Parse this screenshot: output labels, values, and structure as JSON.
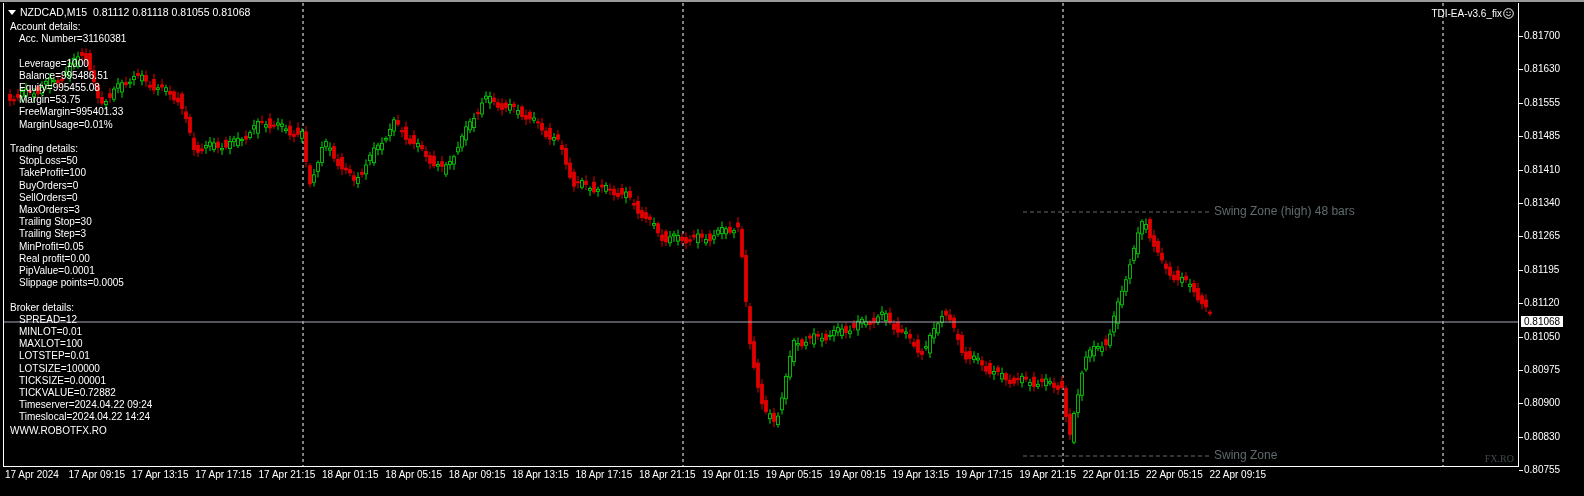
{
  "chart": {
    "symbol": "NZDCAD,M15",
    "quotes": "0.81112 0.81118 0.81055 0.81068",
    "expert": "TDI-EA-v3.6_fix",
    "info_sections": [
      {
        "heading": "Account details:",
        "groups": [
          [
            "Acc. Number=31160381"
          ],
          [
            "Leverage=1000",
            "Balance=995486.51",
            "Equity=995455.08",
            "Margin=53.75",
            "FreeMargin=995401.33",
            "MarginUsage=0.01%"
          ]
        ]
      },
      {
        "heading": "Trading details:",
        "groups": [
          [
            "StopLoss=50",
            "TakeProfit=100",
            "BuyOrders=0",
            "SellOrders=0",
            "MaxOrders=3",
            "Trailing Stop=30",
            "Trailing Step=3",
            "MinProfit=0.05",
            "Real profit=0.00",
            "PipValue=0.0001",
            "Slippage points=0.0005"
          ]
        ]
      },
      {
        "heading": "Broker details:",
        "groups": [
          [
            "SPREAD=12",
            "MINLOT=0.01",
            "MAXLOT=100",
            "LOTSTEP=0.01",
            "LOTSIZE=100000",
            "TICKSIZE=0.00001",
            "TICKVALUE=0.72882",
            "Timeserver=2024.04.22 09:24",
            "Timeslocal=2024.04.22 14:24"
          ]
        ]
      }
    ],
    "website": "WWW.ROBOTFX.RO",
    "swing_zones": [
      {
        "kind": "high",
        "label": "Swing Zone (high) 48 bars"
      },
      {
        "kind": "low",
        "label": "Swing Zone"
      }
    ],
    "corner_text": "FX.RO",
    "current_price": "0.81068"
  },
  "price_axis": [
    "0.81700",
    "0.81630",
    "0.81555",
    "0.81485",
    "0.81410",
    "0.81340",
    "0.81265",
    "0.81195",
    "0.81120",
    "0.81050",
    "0.80975",
    "0.80900",
    "0.80830",
    "0.80755"
  ],
  "time_axis": [
    "17 Apr 2024",
    "17 Apr 09:15",
    "17 Apr 13:15",
    "17 Apr 17:15",
    "17 Apr 21:15",
    "18 Apr 01:15",
    "18 Apr 05:15",
    "18 Apr 09:15",
    "18 Apr 13:15",
    "18 Apr 17:15",
    "18 Apr 21:15",
    "19 Apr 01:15",
    "19 Apr 05:15",
    "19 Apr 09:15",
    "19 Apr 13:15",
    "19 Apr 17:15",
    "19 Apr 21:15",
    "22 Apr 01:15",
    "22 Apr 05:15",
    "22 Apr 09:15"
  ]
}
